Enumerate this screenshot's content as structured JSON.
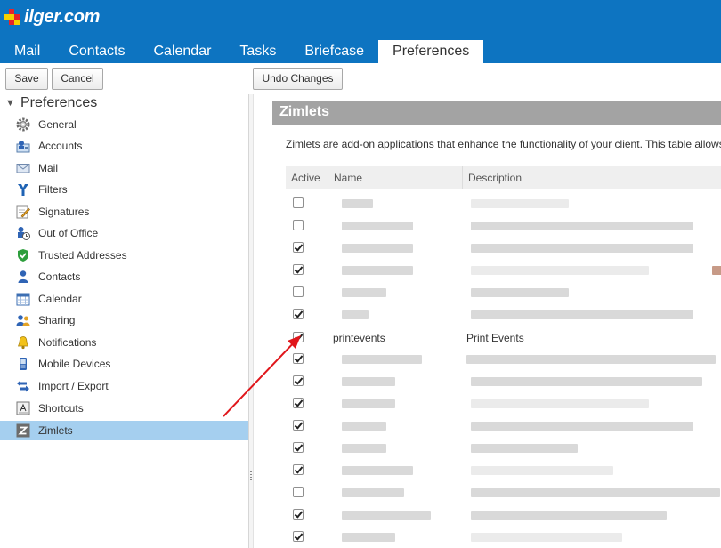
{
  "app": {
    "logo_text": "ilger.com"
  },
  "tabs": [
    {
      "label": "Mail",
      "active": false
    },
    {
      "label": "Contacts",
      "active": false
    },
    {
      "label": "Calendar",
      "active": false
    },
    {
      "label": "Tasks",
      "active": false
    },
    {
      "label": "Briefcase",
      "active": false
    },
    {
      "label": "Preferences",
      "active": true
    }
  ],
  "toolbar": {
    "save_label": "Save",
    "cancel_label": "Cancel",
    "undo_label": "Undo Changes"
  },
  "sidebar": {
    "title": "Preferences",
    "items": [
      {
        "label": "General",
        "icon": "gear-icon"
      },
      {
        "label": "Accounts",
        "icon": "account-icon"
      },
      {
        "label": "Mail",
        "icon": "mail-icon"
      },
      {
        "label": "Filters",
        "icon": "filter-icon"
      },
      {
        "label": "Signatures",
        "icon": "signature-icon"
      },
      {
        "label": "Out of Office",
        "icon": "out-of-office-icon"
      },
      {
        "label": "Trusted Addresses",
        "icon": "shield-check-icon"
      },
      {
        "label": "Contacts",
        "icon": "contact-icon"
      },
      {
        "label": "Calendar",
        "icon": "calendar-icon"
      },
      {
        "label": "Sharing",
        "icon": "sharing-icon"
      },
      {
        "label": "Notifications",
        "icon": "bell-icon"
      },
      {
        "label": "Mobile Devices",
        "icon": "mobile-device-icon"
      },
      {
        "label": "Import / Export",
        "icon": "import-export-icon"
      },
      {
        "label": "Shortcuts",
        "icon": "keyboard-shortcut-icon"
      },
      {
        "label": "Zimlets",
        "icon": "zimlet-icon",
        "selected": true
      }
    ]
  },
  "main": {
    "section_title": "Zimlets",
    "description": "Zimlets are add-on applications that enhance the functionality of your client. This table allows",
    "columns": [
      "Active",
      "Name",
      "Description"
    ],
    "rows": [
      {
        "checked": false,
        "name": "",
        "description": ""
      },
      {
        "checked": false,
        "name": "",
        "description": ""
      },
      {
        "checked": true,
        "name": "",
        "description": ""
      },
      {
        "checked": true,
        "name": "",
        "description": ""
      },
      {
        "checked": false,
        "name": "",
        "description": ""
      },
      {
        "checked": true,
        "name": "",
        "description": ""
      },
      {
        "checked": true,
        "name": "printevents",
        "description": "Print Events"
      },
      {
        "checked": true,
        "name": "",
        "description": ""
      },
      {
        "checked": true,
        "name": "",
        "description": ""
      },
      {
        "checked": true,
        "name": "",
        "description": ""
      },
      {
        "checked": true,
        "name": "",
        "description": ""
      },
      {
        "checked": true,
        "name": "",
        "description": ""
      },
      {
        "checked": true,
        "name": "",
        "description": ""
      },
      {
        "checked": false,
        "name": "",
        "description": ""
      },
      {
        "checked": true,
        "name": "",
        "description": ""
      },
      {
        "checked": true,
        "name": "",
        "description": ""
      }
    ]
  },
  "colors": {
    "header_blue": "#0d74c1",
    "selected_row": "#a5cfef",
    "annotation_arrow": "#e0161b",
    "section_bar": "#a3a3a3"
  }
}
